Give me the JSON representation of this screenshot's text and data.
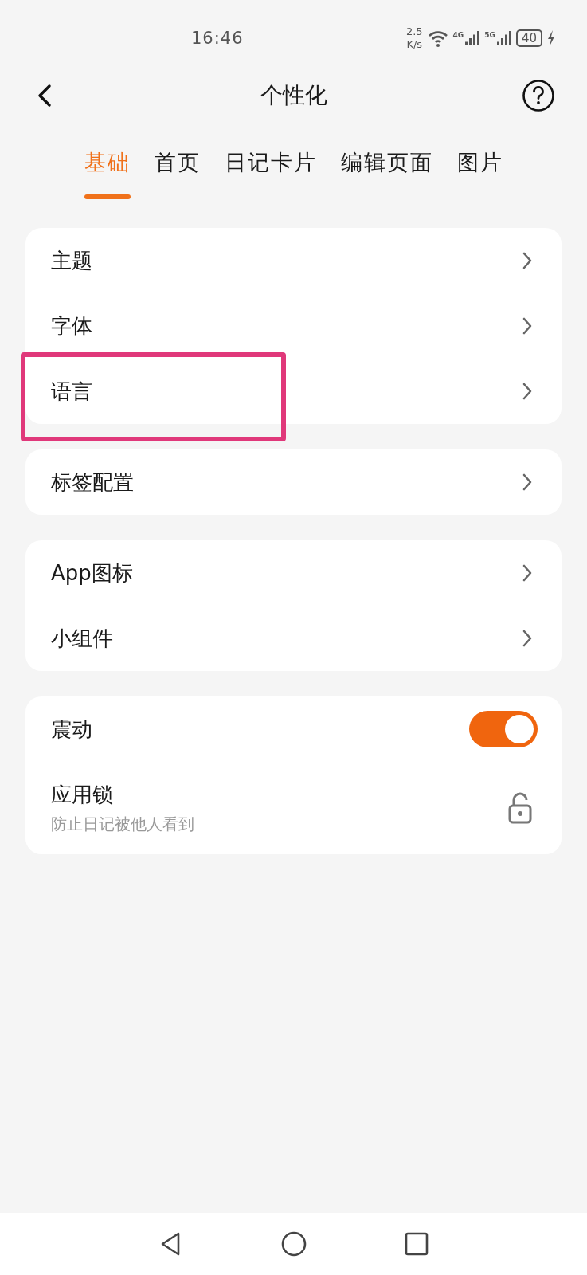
{
  "status_bar": {
    "time": "16:46",
    "speed_value": "2.5",
    "speed_unit": "K/s",
    "network_1": "4G",
    "network_2": "5G",
    "battery": "40"
  },
  "header": {
    "title": "个性化"
  },
  "tabs": [
    {
      "label": "基础",
      "selected": true
    },
    {
      "label": "首页",
      "selected": false
    },
    {
      "label": "日记卡片",
      "selected": false
    },
    {
      "label": "编辑页面",
      "selected": false
    },
    {
      "label": "图片",
      "selected": false
    }
  ],
  "groups": [
    {
      "rows": [
        {
          "kind": "link",
          "label": "主题"
        },
        {
          "kind": "link",
          "label": "字体"
        },
        {
          "kind": "link",
          "label": "语言",
          "highlighted": true
        }
      ]
    },
    {
      "rows": [
        {
          "kind": "link",
          "label": "标签配置"
        }
      ]
    },
    {
      "rows": [
        {
          "kind": "link",
          "label": "App图标"
        },
        {
          "kind": "link",
          "label": "小组件"
        }
      ]
    },
    {
      "rows": [
        {
          "kind": "toggle",
          "label": "震动",
          "on": true
        },
        {
          "kind": "lock",
          "label": "应用锁",
          "subtitle": "防止日记被他人看到"
        }
      ]
    }
  ]
}
